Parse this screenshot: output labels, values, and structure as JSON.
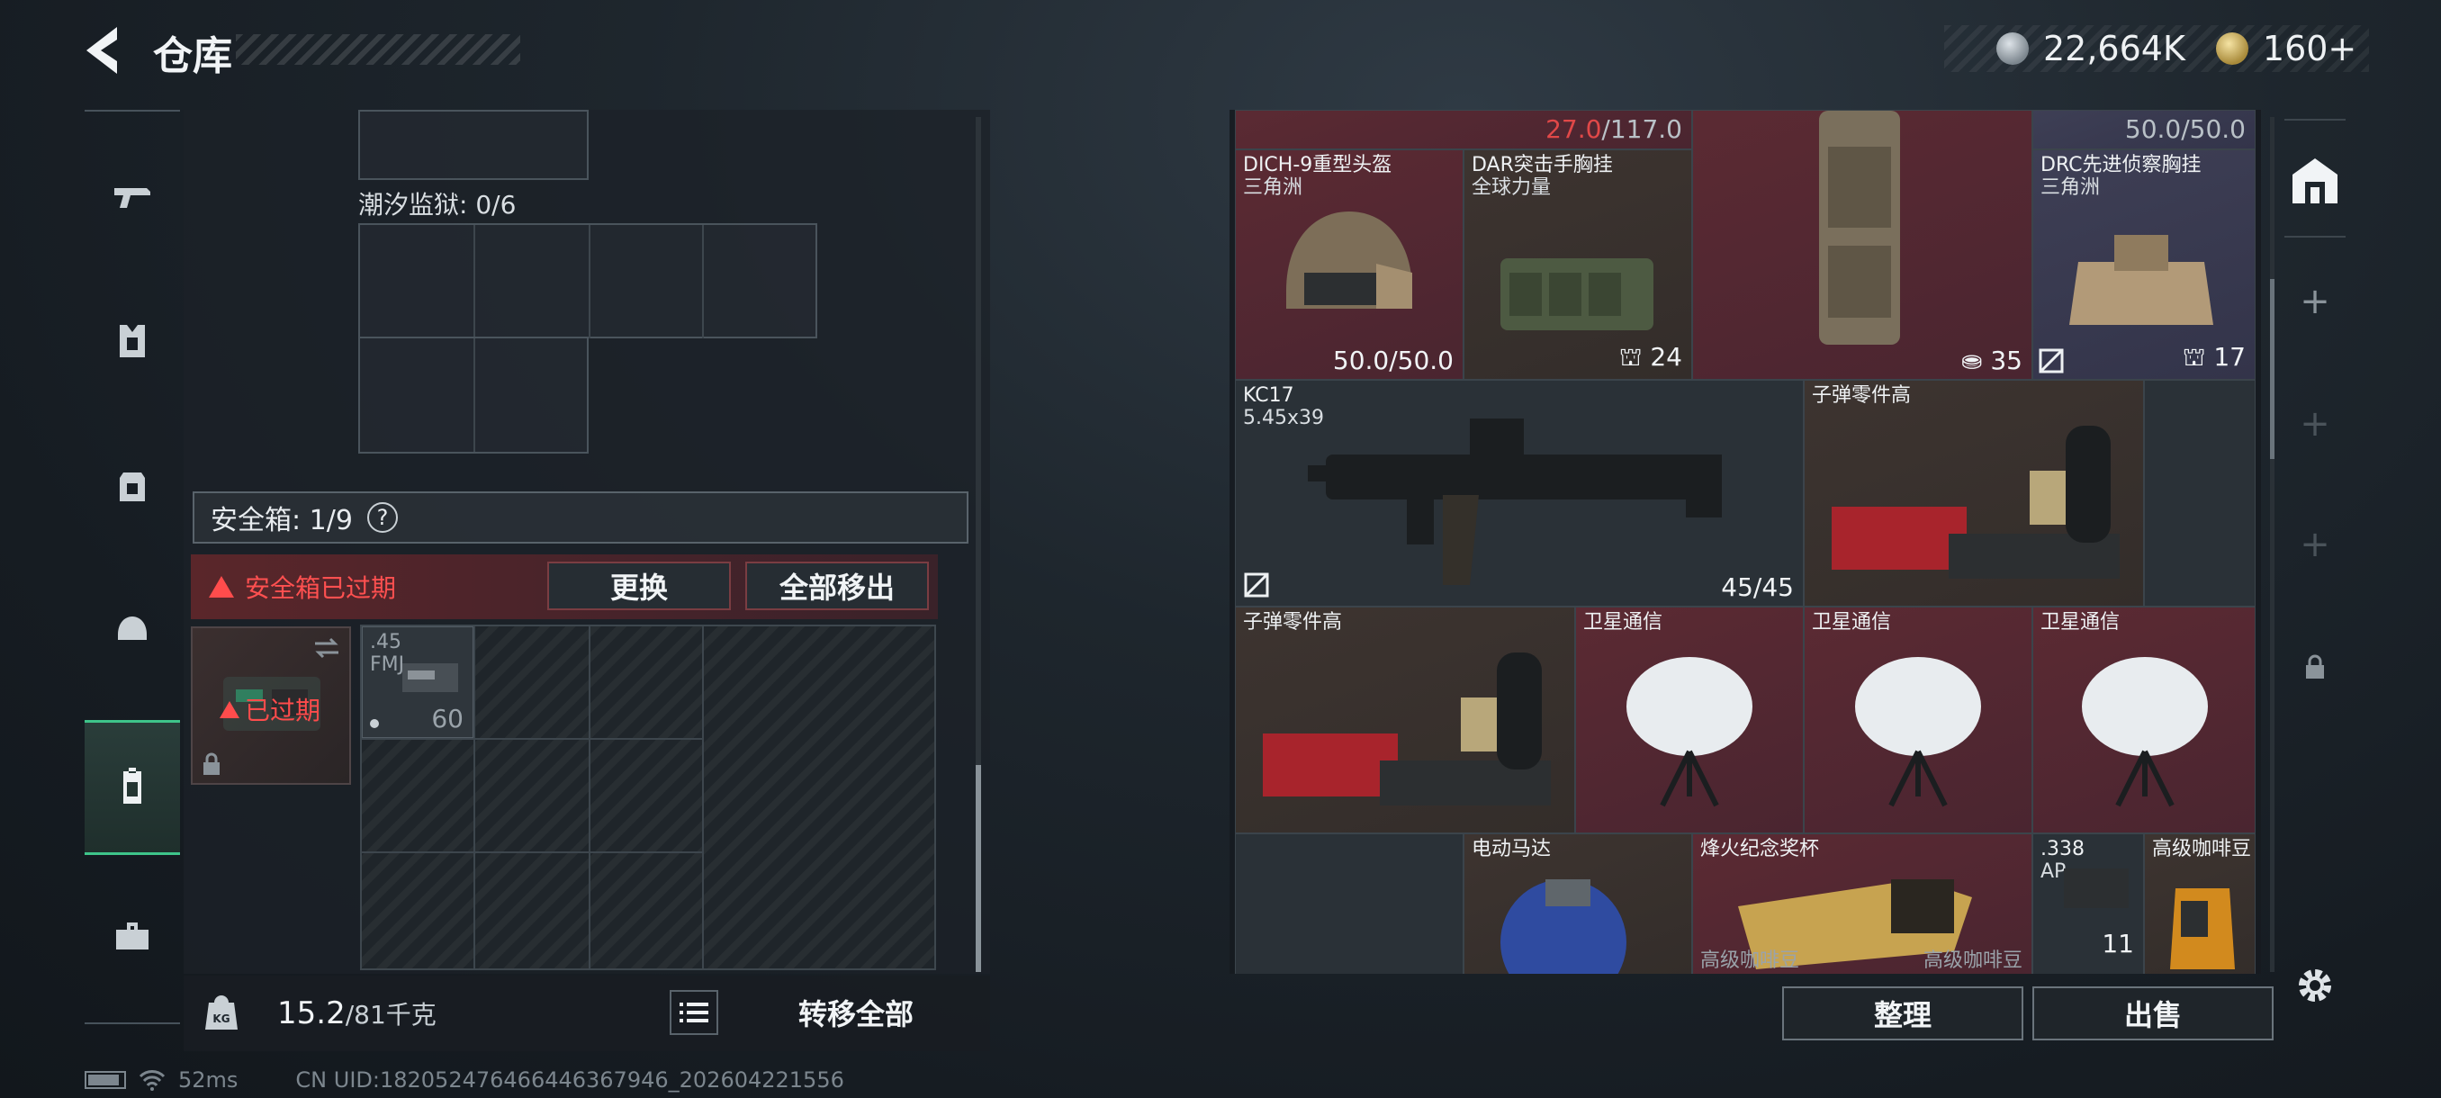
{
  "header": {
    "title": "仓库",
    "currency_primary": "22,664K",
    "currency_secondary": "160+"
  },
  "left_tabs": [
    {
      "name": "weapons"
    },
    {
      "name": "armor-vest"
    },
    {
      "name": "backpack"
    },
    {
      "name": "helmet"
    },
    {
      "name": "safe-box",
      "active": true
    },
    {
      "name": "toolbox"
    }
  ],
  "storage": {
    "tide_prison_label": "潮汐监狱: 0/6",
    "safe_box_label": "安全箱: 1/9",
    "help_symbol": "?",
    "expired_warning": "安全箱已过期",
    "replace_button": "更换",
    "remove_all_button": "全部移出",
    "safe_expired_tag": "已过期",
    "ammo_item": {
      "name": ".45",
      "sub": "FMJ",
      "count": "60"
    }
  },
  "bottom_left": {
    "weight_value": "15.2",
    "weight_max": "/81千克",
    "transfer_all_button": "转移全部"
  },
  "status": {
    "ping": "52ms",
    "uid": "CN UID:182052476466446367946_202604221556"
  },
  "inventory": {
    "top_left_value_red": "27.0",
    "top_left_value": "/117.0",
    "top_right_value": "50.0/50.0",
    "items": [
      {
        "name": "DICH-9重型头盔",
        "sub": "三角洲",
        "count": "50.0/50.0"
      },
      {
        "name": "DAR突击手胸挂",
        "sub": "全球力量",
        "count": "24"
      },
      {
        "name": "",
        "sub": "",
        "count": "35"
      },
      {
        "name": "DRC先进侦察胸挂",
        "sub": "三角洲",
        "count": "17"
      },
      {
        "name": "KC17",
        "sub": "5.45x39",
        "count": "45/45"
      },
      {
        "name": "子弹零件高",
        "sub": "",
        "count": ""
      },
      {
        "name": "子弹零件高",
        "sub": "",
        "count": ""
      },
      {
        "name": "卫星通信",
        "sub": "",
        "count": ""
      },
      {
        "name": "卫星通信",
        "sub": "",
        "count": ""
      },
      {
        "name": "卫星通信",
        "sub": "",
        "count": ""
      },
      {
        "name": "电动马达",
        "sub": "",
        "count": ""
      },
      {
        "name": "烽火纪念奖杯",
        "sub": "",
        "count": ""
      },
      {
        "name": ".338",
        "sub": "AP",
        "count": "11"
      },
      {
        "name": "高级咖啡豆",
        "sub": "",
        "count": ""
      },
      {
        "name": "高级咖啡豆",
        "sub": "",
        "count": ""
      },
      {
        "name": "高级咖啡豆",
        "sub": "",
        "count": ""
      }
    ]
  },
  "right_bottom": {
    "organize_button": "整理",
    "sell_button": "出售"
  }
}
